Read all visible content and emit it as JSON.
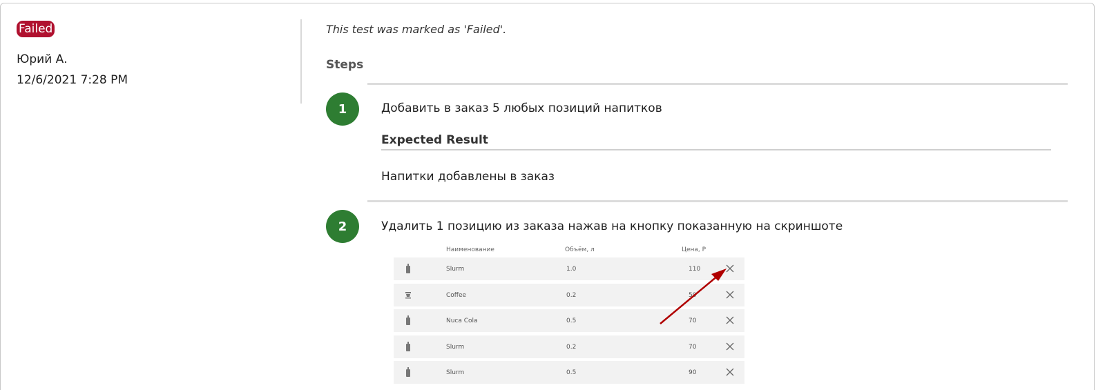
{
  "status": {
    "label": "Failed",
    "color": "#b0112f"
  },
  "author": "Юрий А.",
  "date": "12/6/2021 7:28 PM",
  "note": "This test was marked as 'Failed'.",
  "steps_heading": "Steps",
  "steps": [
    {
      "number": "1",
      "text": "Добавить в заказ 5 любых позиций напитков"
    },
    {
      "number": "2",
      "text": "Удалить 1 позицию из заказа нажав на кнопку показанную на скриншоте"
    }
  ],
  "expected_label": "Expected Result",
  "expected_text": "Напитки добавлены в заказ",
  "screenshot": {
    "headers": {
      "name": "Наименование",
      "volume": "Объём, л",
      "price": "Цена, Р"
    },
    "rows": [
      {
        "icon": "bottle-icon",
        "name": "Slurm",
        "volume": "1.0",
        "price": "110"
      },
      {
        "icon": "coffee-cup-icon",
        "name": "Coffee",
        "volume": "0.2",
        "price": "50"
      },
      {
        "icon": "bottle-icon",
        "name": "Nuca Cola",
        "volume": "0.5",
        "price": "70"
      },
      {
        "icon": "bottle-icon",
        "name": "Slurm",
        "volume": "0.2",
        "price": "70"
      },
      {
        "icon": "bottle-icon",
        "name": "Slurm",
        "volume": "0.5",
        "price": "90"
      }
    ],
    "arrow_color": "#b00000"
  }
}
